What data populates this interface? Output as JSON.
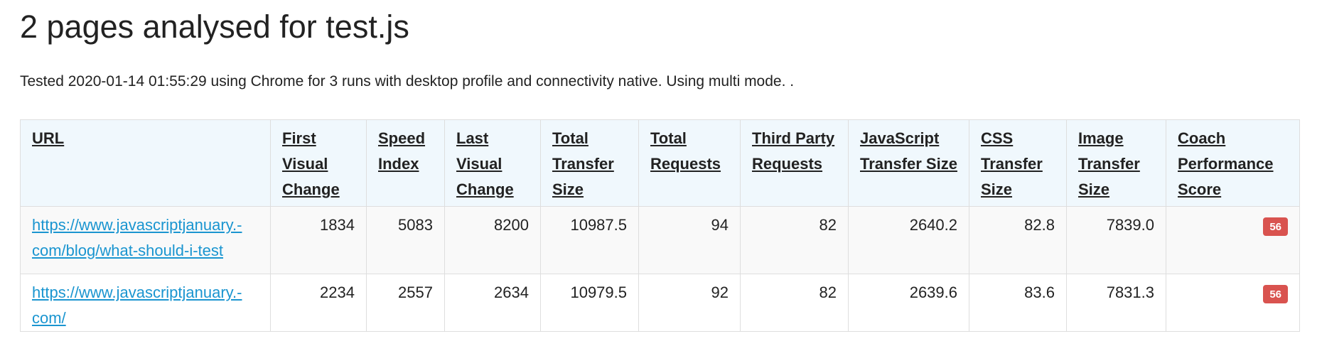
{
  "page": {
    "title": "2 pages analysed for test.js",
    "summary": "Tested 2020-01-14 01:55:29 using Chrome for 3 runs with desktop profile and connectivity native. Using multi mode.  ."
  },
  "table": {
    "headers": [
      "URL",
      "First Visual Change",
      "Speed Index",
      "Last Visual Change",
      "Total Transfer Size",
      "Total Requests",
      "Third Party Requests",
      "JavaScript Transfer Size",
      "CSS Transfer Size",
      "Image Transfer Size",
      "Coach Performance Score"
    ],
    "rows": [
      {
        "url_line1": "https://www.javascriptjanuary.-",
        "url_line2": "com/blog/what-should-i-test",
        "first_visual_change": "1834",
        "speed_index": "5083",
        "last_visual_change": "8200",
        "total_transfer_size": "10987.5",
        "total_requests": "94",
        "third_party_requests": "82",
        "javascript_transfer_size": "2640.2",
        "css_transfer_size": "82.8",
        "image_transfer_size": "7839.0",
        "coach_score": "56"
      },
      {
        "url_line1": "https://www.javascriptjanuary.-",
        "url_line2": "com/",
        "first_visual_change": "2234",
        "speed_index": "2557",
        "last_visual_change": "2634",
        "total_transfer_size": "10979.5",
        "total_requests": "92",
        "third_party_requests": "82",
        "javascript_transfer_size": "2639.6",
        "css_transfer_size": "83.6",
        "image_transfer_size": "7831.3",
        "coach_score": "56"
      }
    ]
  },
  "colors": {
    "header_bg": "#f0f8fd",
    "link": "#1a95d0",
    "score_badge": "#d9534f",
    "row_alt": "#f9f9f9"
  }
}
